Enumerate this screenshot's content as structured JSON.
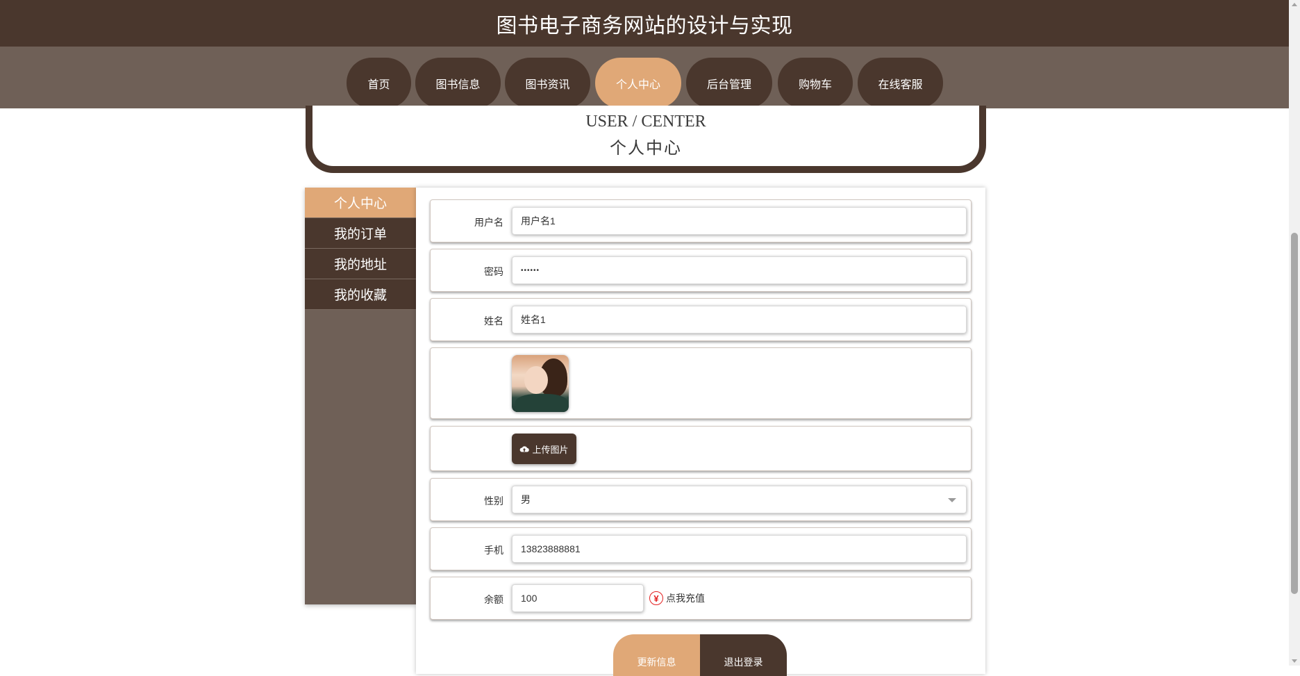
{
  "header": {
    "title": "图书电子商务网站的设计与实现"
  },
  "nav": {
    "items": [
      {
        "label": "首页"
      },
      {
        "label": "图书信息"
      },
      {
        "label": "图书资讯"
      },
      {
        "label": "个人中心"
      },
      {
        "label": "后台管理"
      },
      {
        "label": "购物车"
      },
      {
        "label": "在线客服"
      }
    ],
    "active": "个人中心"
  },
  "banner": {
    "en": "USER / CENTER",
    "zh": "个人中心"
  },
  "sidebar": {
    "items": [
      {
        "label": "个人中心"
      },
      {
        "label": "我的订单"
      },
      {
        "label": "我的地址"
      },
      {
        "label": "我的收藏"
      }
    ],
    "active": "个人中心"
  },
  "form": {
    "username": {
      "label": "用户名",
      "value": "用户名1"
    },
    "password": {
      "label": "密码",
      "value": "••••••"
    },
    "name": {
      "label": "姓名",
      "value": "姓名1"
    },
    "upload_label": "上传图片",
    "gender": {
      "label": "性别",
      "value": "男"
    },
    "phone": {
      "label": "手机",
      "value": "13823888881"
    },
    "balance": {
      "label": "余额",
      "value": "100",
      "recharge_label": "点我充值",
      "recharge_icon": "yen-icon"
    }
  },
  "actions": {
    "update_label": "更新信息",
    "logout_label": "退出登录"
  },
  "colors": {
    "primary": "#4a372d",
    "accent": "#e0a877",
    "nav_bg": "#6f6057"
  }
}
